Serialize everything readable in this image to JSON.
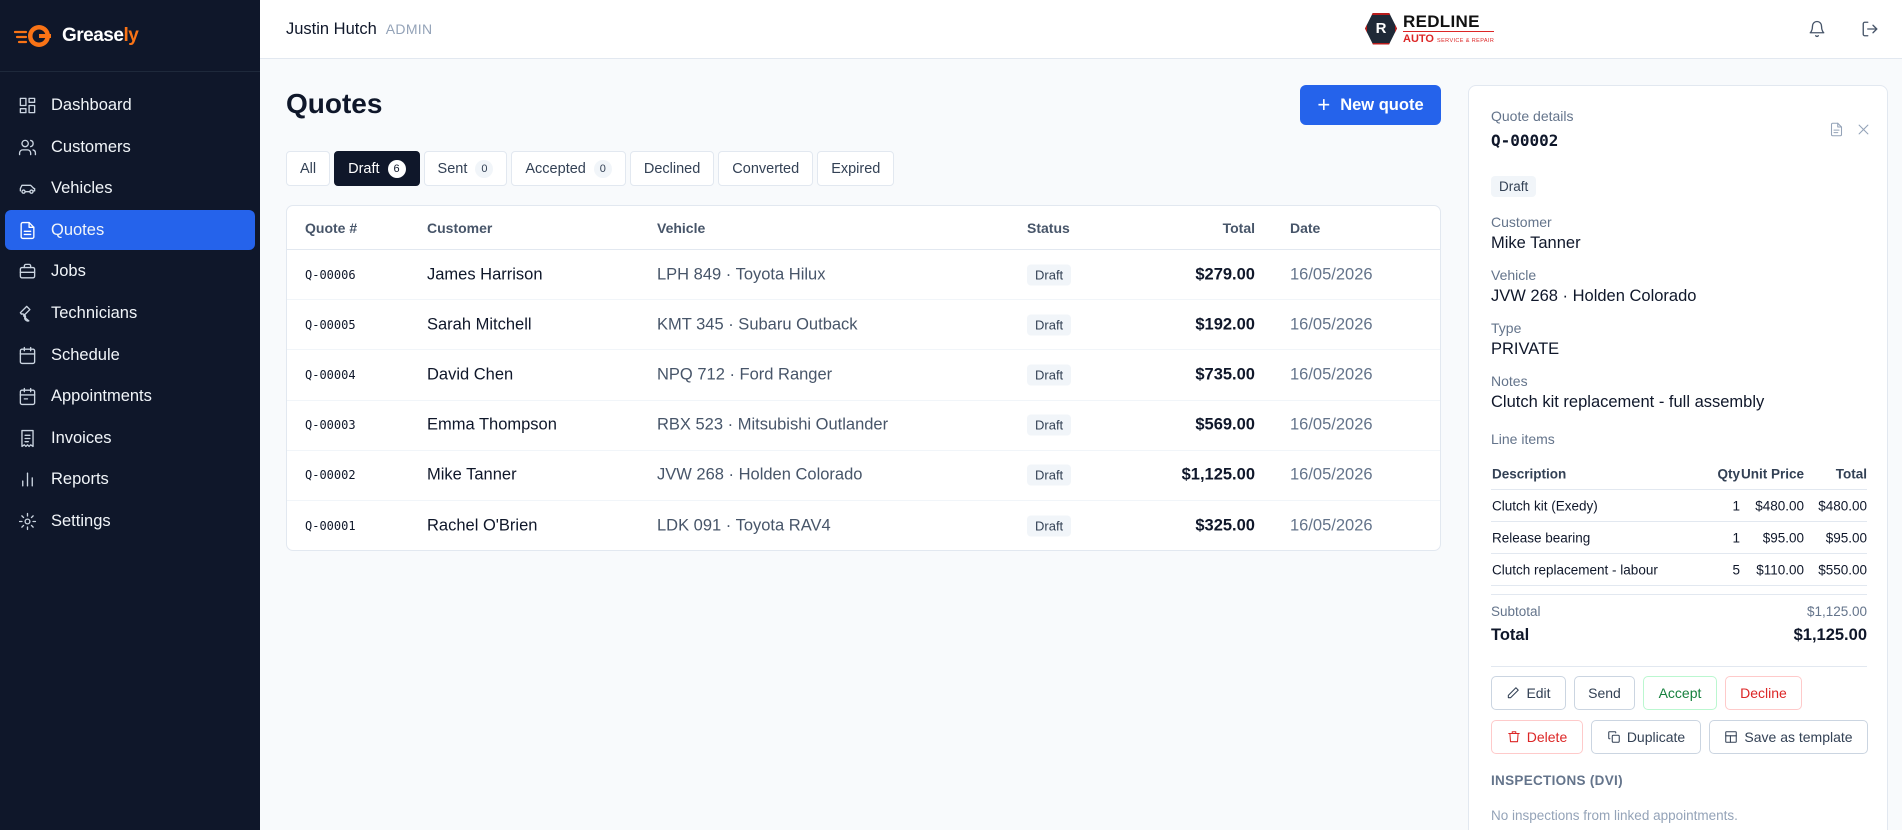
{
  "app": {
    "name_main": "Grease",
    "name_accent": "ly"
  },
  "header": {
    "user_name": "Justin Hutch",
    "user_role": "ADMIN",
    "brand_line1": "REDLINE",
    "brand_line2": "AUTO",
    "brand_tag": "SERVICE & REPAIR",
    "brand_initial": "R"
  },
  "sidebar": {
    "items": [
      {
        "label": "Dashboard",
        "icon": "dashboard-icon"
      },
      {
        "label": "Customers",
        "icon": "users-icon"
      },
      {
        "label": "Vehicles",
        "icon": "car-icon"
      },
      {
        "label": "Quotes",
        "icon": "document-icon",
        "active": true
      },
      {
        "label": "Jobs",
        "icon": "briefcase-icon"
      },
      {
        "label": "Technicians",
        "icon": "wrench-icon"
      },
      {
        "label": "Schedule",
        "icon": "calendar-icon"
      },
      {
        "label": "Appointments",
        "icon": "calendar-check-icon"
      },
      {
        "label": "Invoices",
        "icon": "receipt-icon"
      },
      {
        "label": "Reports",
        "icon": "bar-chart-icon"
      },
      {
        "label": "Settings",
        "icon": "gear-icon"
      }
    ]
  },
  "main": {
    "title": "Quotes",
    "new_button": "New quote",
    "tabs": [
      {
        "label": "All",
        "count": ""
      },
      {
        "label": "Draft",
        "count": "6",
        "active": true
      },
      {
        "label": "Sent",
        "count": "0"
      },
      {
        "label": "Accepted",
        "count": "0"
      },
      {
        "label": "Declined",
        "count": ""
      },
      {
        "label": "Converted",
        "count": ""
      },
      {
        "label": "Expired",
        "count": ""
      }
    ],
    "columns": {
      "quote": "Quote #",
      "customer": "Customer",
      "vehicle": "Vehicle",
      "status": "Status",
      "total": "Total",
      "date": "Date"
    },
    "rows": [
      {
        "quote": "Q-00006",
        "customer": "James Harrison",
        "vehicle": "LPH 849 · Toyota Hilux",
        "status": "Draft",
        "total": "$279.00",
        "date": "16/05/2026"
      },
      {
        "quote": "Q-00005",
        "customer": "Sarah Mitchell",
        "vehicle": "KMT 345 · Subaru Outback",
        "status": "Draft",
        "total": "$192.00",
        "date": "16/05/2026"
      },
      {
        "quote": "Q-00004",
        "customer": "David Chen",
        "vehicle": "NPQ 712 · Ford Ranger",
        "status": "Draft",
        "total": "$735.00",
        "date": "16/05/2026"
      },
      {
        "quote": "Q-00003",
        "customer": "Emma Thompson",
        "vehicle": "RBX 523 · Mitsubishi Outlander",
        "status": "Draft",
        "total": "$569.00",
        "date": "16/05/2026"
      },
      {
        "quote": "Q-00002",
        "customer": "Mike Tanner",
        "vehicle": "JVW 268 · Holden Colorado",
        "status": "Draft",
        "total": "$1,125.00",
        "date": "16/05/2026"
      },
      {
        "quote": "Q-00001",
        "customer": "Rachel O'Brien",
        "vehicle": "LDK 091 · Toyota RAV4",
        "status": "Draft",
        "total": "$325.00",
        "date": "16/05/2026"
      }
    ]
  },
  "details": {
    "heading": "Quote details",
    "quote_id": "Q-00002",
    "status": "Draft",
    "customer_label": "Customer",
    "customer": "Mike Tanner",
    "vehicle_label": "Vehicle",
    "vehicle": "JVW 268 · Holden Colorado",
    "type_label": "Type",
    "type": "PRIVATE",
    "notes_label": "Notes",
    "notes": "Clutch kit replacement - full assembly",
    "line_items_label": "Line items",
    "li_cols": {
      "desc": "Description",
      "qty": "Qty",
      "unit": "Unit Price",
      "total": "Total"
    },
    "line_items": [
      {
        "desc": "Clutch kit (Exedy)",
        "qty": "1",
        "unit": "$480.00",
        "total": "$480.00"
      },
      {
        "desc": "Release bearing",
        "qty": "1",
        "unit": "$95.00",
        "total": "$95.00"
      },
      {
        "desc": "Clutch replacement - labour",
        "qty": "5",
        "unit": "$110.00",
        "total": "$550.00"
      }
    ],
    "subtotal_label": "Subtotal",
    "subtotal": "$1,125.00",
    "total_label": "Total",
    "total": "$1,125.00",
    "actions": {
      "edit": "Edit",
      "send": "Send",
      "accept": "Accept",
      "decline": "Decline",
      "delete": "Delete",
      "duplicate": "Duplicate",
      "save_template": "Save as template"
    },
    "inspections_label": "INSPECTIONS (DVI)",
    "inspections_empty": "No inspections from linked appointments."
  },
  "colors": {
    "sidebar_bg": "#0f172a",
    "accent": "#2563eb",
    "brand_orange": "#f97316",
    "danger": "#dc2626",
    "success": "#15803d"
  }
}
